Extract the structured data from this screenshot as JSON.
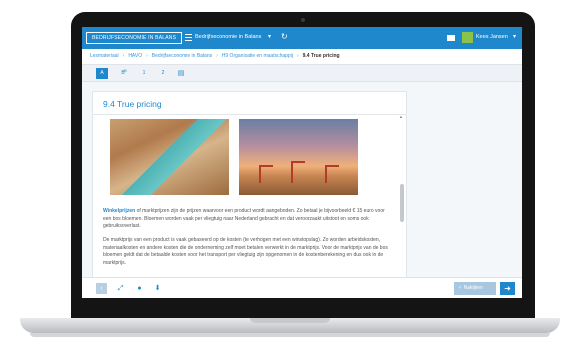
{
  "app": {
    "brand": "BEDRIJFSECONOMIE IN BALANS",
    "book_title": "Bedrijfseconomie in Balans",
    "user_name": "Kees Jansen"
  },
  "breadcrumb": [
    "Lesmateriaal",
    "HAVO",
    "Bedrijfseconomie in Balans",
    "H9 Organisatie en maatschappij",
    "9.4 True pricing"
  ],
  "toolbar": {
    "items": [
      "A",
      "B",
      "1",
      "2"
    ],
    "superscripts": [
      "A",
      "B"
    ]
  },
  "content": {
    "title": "9.4 True pricing",
    "keyword": "Winkelprijzen",
    "paragraph1_rest": " of marktprijzen zijn de prijzen waarvoor een product wordt aangeboden. Zo betaal je bijvoorbeeld € 15 euro voor een bos bloemen. Bloemen worden vaak per vliegtuig naar Nederland gebracht en dat veroorzaakt uitstoot en soms ook gebruiksoverlast.",
    "paragraph2": "De marktprijs van een product is vaak gebaseerd op de kosten (te verhogen met een winstopslag). Zo worden arbeidskosten, materiaalkosten en andere kosten die de onderneming zelf moet betalen verwerkt in de marktprijs. Voor de marktprijs van de bos bloemen geldt dat de betaalde kosten voor het transport per vliegtuig zijn opgenomen in de kostenberekening en dus ook in de marktprijs."
  },
  "footer": {
    "check_button": "Nakijken"
  },
  "colors": {
    "accent": "#1f88cc"
  }
}
